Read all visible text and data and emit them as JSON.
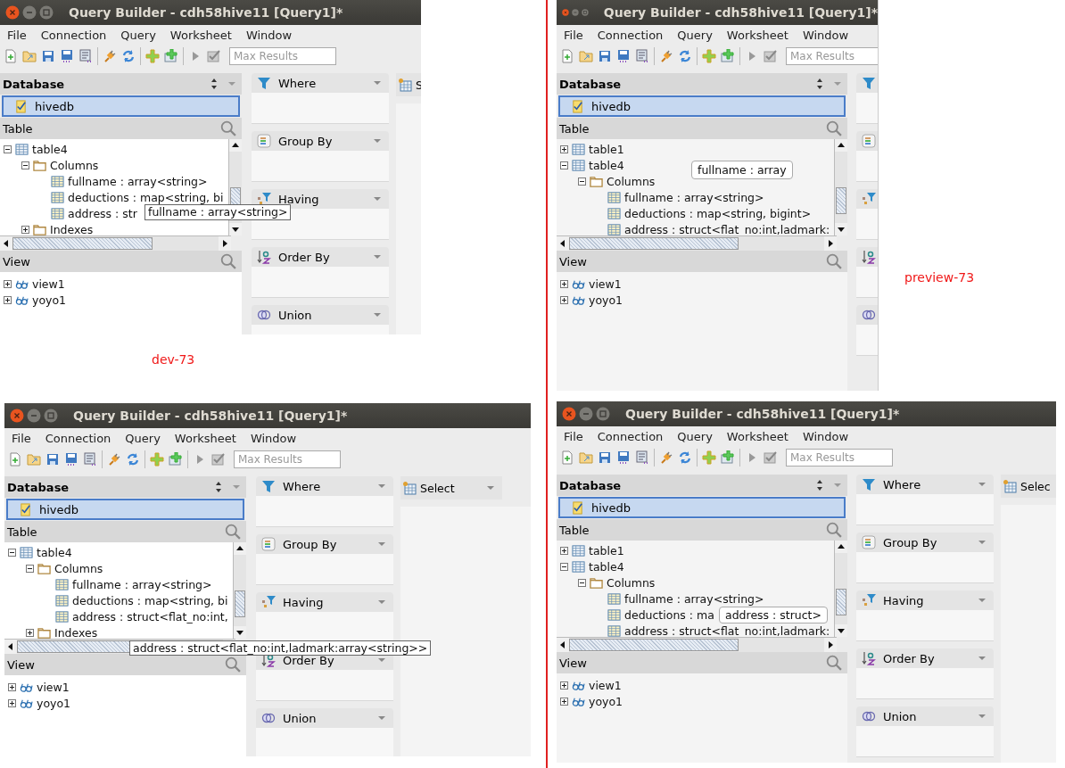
{
  "windows": [
    {
      "title": "Query Builder - cdh58hive11 [Query1]*",
      "menu": [
        "File",
        "Connection",
        "Query",
        "Worksheet",
        "Window"
      ],
      "max_results": {
        "placeholder": "Max Results"
      },
      "database": {
        "label": "Database",
        "item": {
          "label": "hivedb",
          "checked": true,
          "selected": true
        }
      },
      "table_section": {
        "label": "Table",
        "tree": [
          {
            "kind": "table",
            "label": "table4",
            "expanded": true,
            "children": [
              {
                "kind": "folder",
                "label": "Columns",
                "expanded": true,
                "children": [
                  {
                    "kind": "column",
                    "label": "fullname : array<string>"
                  },
                  {
                    "kind": "column",
                    "label": "deductions : map<string, bi"
                  },
                  {
                    "kind": "column",
                    "label": "address : str"
                  }
                ]
              },
              {
                "kind": "folder",
                "label": "Indexes",
                "expanded": false
              }
            ]
          }
        ]
      },
      "view_section": {
        "label": "View",
        "tree": [
          {
            "kind": "view",
            "label": "view1",
            "expanded": false
          },
          {
            "kind": "view",
            "label": "yoyo1",
            "expanded": false
          }
        ]
      },
      "panels": [
        {
          "kind": "where",
          "label": "Where"
        },
        {
          "kind": "group",
          "label": "Group By"
        },
        {
          "kind": "having",
          "label": "Having"
        },
        {
          "kind": "order",
          "label": "Order By"
        },
        {
          "kind": "union",
          "label": "Union"
        }
      ],
      "select": {
        "label": "S"
      },
      "tooltip": {
        "kind": "plain",
        "text": "fullname : array<string>"
      }
    },
    {
      "title": "Query Builder - cdh58hive11 [Query1]*",
      "menu": [
        "File",
        "Connection",
        "Query",
        "Worksheet",
        "Window"
      ],
      "max_results": {
        "placeholder": "Max Results"
      },
      "database": {
        "label": "Database",
        "item": {
          "label": "hivedb",
          "checked": true,
          "selected": true
        }
      },
      "table_section": {
        "label": "Table",
        "tree": [
          {
            "kind": "table",
            "label": "table1",
            "expanded": false
          },
          {
            "kind": "table",
            "label": "table4",
            "expanded": true,
            "children": [
              {
                "kind": "folder",
                "label": "Columns",
                "expanded": true,
                "children": [
                  {
                    "kind": "column",
                    "label": "fullname : array<string>"
                  },
                  {
                    "kind": "column",
                    "label": "deductions : map<string, bigint>"
                  },
                  {
                    "kind": "column",
                    "label": "address : struct<flat_no:int,ladmark:"
                  }
                ]
              }
            ]
          }
        ]
      },
      "view_section": {
        "label": "View",
        "tree": [
          {
            "kind": "view",
            "label": "view1",
            "expanded": false
          },
          {
            "kind": "view",
            "label": "yoyo1",
            "expanded": false
          }
        ]
      },
      "panels": [
        {
          "kind": "where"
        },
        {
          "kind": "group"
        },
        {
          "kind": "having"
        },
        {
          "kind": "order"
        },
        {
          "kind": "union"
        }
      ],
      "tooltip": {
        "kind": "balloon",
        "text": "fullname : array"
      }
    },
    {
      "title": "Query Builder - cdh58hive11 [Query1]*",
      "menu": [
        "File",
        "Connection",
        "Query",
        "Worksheet",
        "Window"
      ],
      "max_results": {
        "placeholder": "Max Results"
      },
      "database": {
        "label": "Database",
        "item": {
          "label": "hivedb",
          "checked": true,
          "selected": true
        }
      },
      "table_section": {
        "label": "Table",
        "tree": [
          {
            "kind": "table",
            "label": "table4",
            "expanded": true,
            "children": [
              {
                "kind": "folder",
                "label": "Columns",
                "expanded": true,
                "children": [
                  {
                    "kind": "column",
                    "label": "fullname : array<string>"
                  },
                  {
                    "kind": "column",
                    "label": "deductions : map<string, bi"
                  },
                  {
                    "kind": "column",
                    "label": "address : struct<flat_no:int,"
                  }
                ]
              },
              {
                "kind": "folder",
                "label": "Indexes",
                "expanded": false
              }
            ]
          }
        ]
      },
      "view_section": {
        "label": "View",
        "tree": [
          {
            "kind": "view",
            "label": "view1",
            "expanded": false
          },
          {
            "kind": "view",
            "label": "yoyo1",
            "expanded": false
          }
        ]
      },
      "panels": [
        {
          "kind": "where",
          "label": "Where"
        },
        {
          "kind": "group",
          "label": "Group By"
        },
        {
          "kind": "having",
          "label": "Having"
        },
        {
          "kind": "order",
          "label": "Order By"
        },
        {
          "kind": "union",
          "label": "Union"
        }
      ],
      "select": {
        "label": "Select"
      },
      "tooltip": {
        "kind": "plain",
        "text": "address : struct<flat_no:int,ladmark:array<string>>"
      }
    },
    {
      "title": "Query Builder - cdh58hive11 [Query1]*",
      "menu": [
        "File",
        "Connection",
        "Query",
        "Worksheet",
        "Window"
      ],
      "max_results": {
        "placeholder": "Max Results"
      },
      "database": {
        "label": "Database",
        "item": {
          "label": "hivedb",
          "checked": true,
          "selected": true
        }
      },
      "table_section": {
        "label": "Table",
        "tree": [
          {
            "kind": "table",
            "label": "table1",
            "expanded": false
          },
          {
            "kind": "table",
            "label": "table4",
            "expanded": true,
            "children": [
              {
                "kind": "folder",
                "label": "Columns",
                "expanded": true,
                "children": [
                  {
                    "kind": "column",
                    "label": "fullname : array<string>"
                  },
                  {
                    "kind": "column",
                    "label": "deductions : ma"
                  },
                  {
                    "kind": "column",
                    "label": "address : struct<flat_no:int,ladmark:"
                  }
                ]
              }
            ]
          }
        ]
      },
      "view_section": {
        "label": "View",
        "tree": [
          {
            "kind": "view",
            "label": "view1",
            "expanded": false
          },
          {
            "kind": "view",
            "label": "yoyo1",
            "expanded": false
          }
        ]
      },
      "panels": [
        {
          "kind": "where",
          "label": "Where"
        },
        {
          "kind": "group",
          "label": "Group By"
        },
        {
          "kind": "having",
          "label": "Having"
        },
        {
          "kind": "order",
          "label": "Order By"
        },
        {
          "kind": "union",
          "label": "Union"
        }
      ],
      "select": {
        "label": "Selec"
      },
      "tooltip": {
        "kind": "balloon",
        "text": "address : struct>"
      }
    }
  ],
  "captions": [
    "dev-73",
    "preview-73"
  ]
}
